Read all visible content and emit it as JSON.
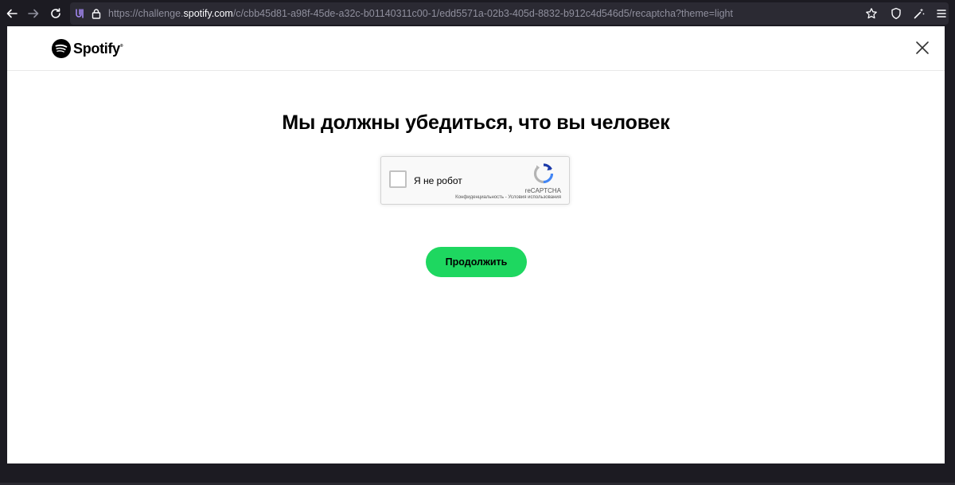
{
  "browser": {
    "url_prefix": "https://challenge.",
    "url_host": "spotify.com",
    "url_path": "/c/cbb45d81-a98f-45de-a32c-b01140311c00-1/edd5571a-02b3-405d-8832-b912c4d546d5/recaptcha?theme=light"
  },
  "header": {
    "logo_text": "Spotify",
    "logo_mark": "®"
  },
  "main": {
    "title": "Мы должны убедиться, что вы человек",
    "continue_label": "Продолжить"
  },
  "recaptcha": {
    "checkbox_label": "Я не робот",
    "brand": "reCAPTCHA",
    "privacy_link": "Конфиденциальность",
    "separator": " - ",
    "terms_link": "Условия использования"
  },
  "colors": {
    "accent": "#1ed760",
    "toolbar_bg": "#1c1b22",
    "urlbar_bg": "#2b2a33"
  }
}
